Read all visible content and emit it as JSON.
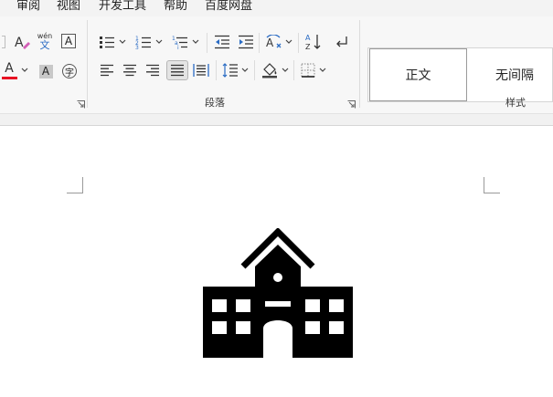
{
  "menu": {
    "items": [
      "审阅",
      "视图",
      "开发工具",
      "帮助",
      "百度网盘"
    ]
  },
  "ribbon": {
    "font_group": {
      "phonetic_label": "wén",
      "phonetic_char": "文",
      "char_border_label": "A",
      "font_color_label": "A",
      "char_shading_label": "A",
      "enclose_char_label": "字",
      "font_color": "#e81123"
    },
    "paragraph_group": {
      "label": "段落"
    },
    "styles_group": {
      "label": "样式",
      "items": [
        {
          "label": "正文",
          "selected": true
        },
        {
          "label": "无间隔",
          "selected": false
        }
      ]
    }
  },
  "document": {
    "image_icon": "school-building-icon"
  }
}
